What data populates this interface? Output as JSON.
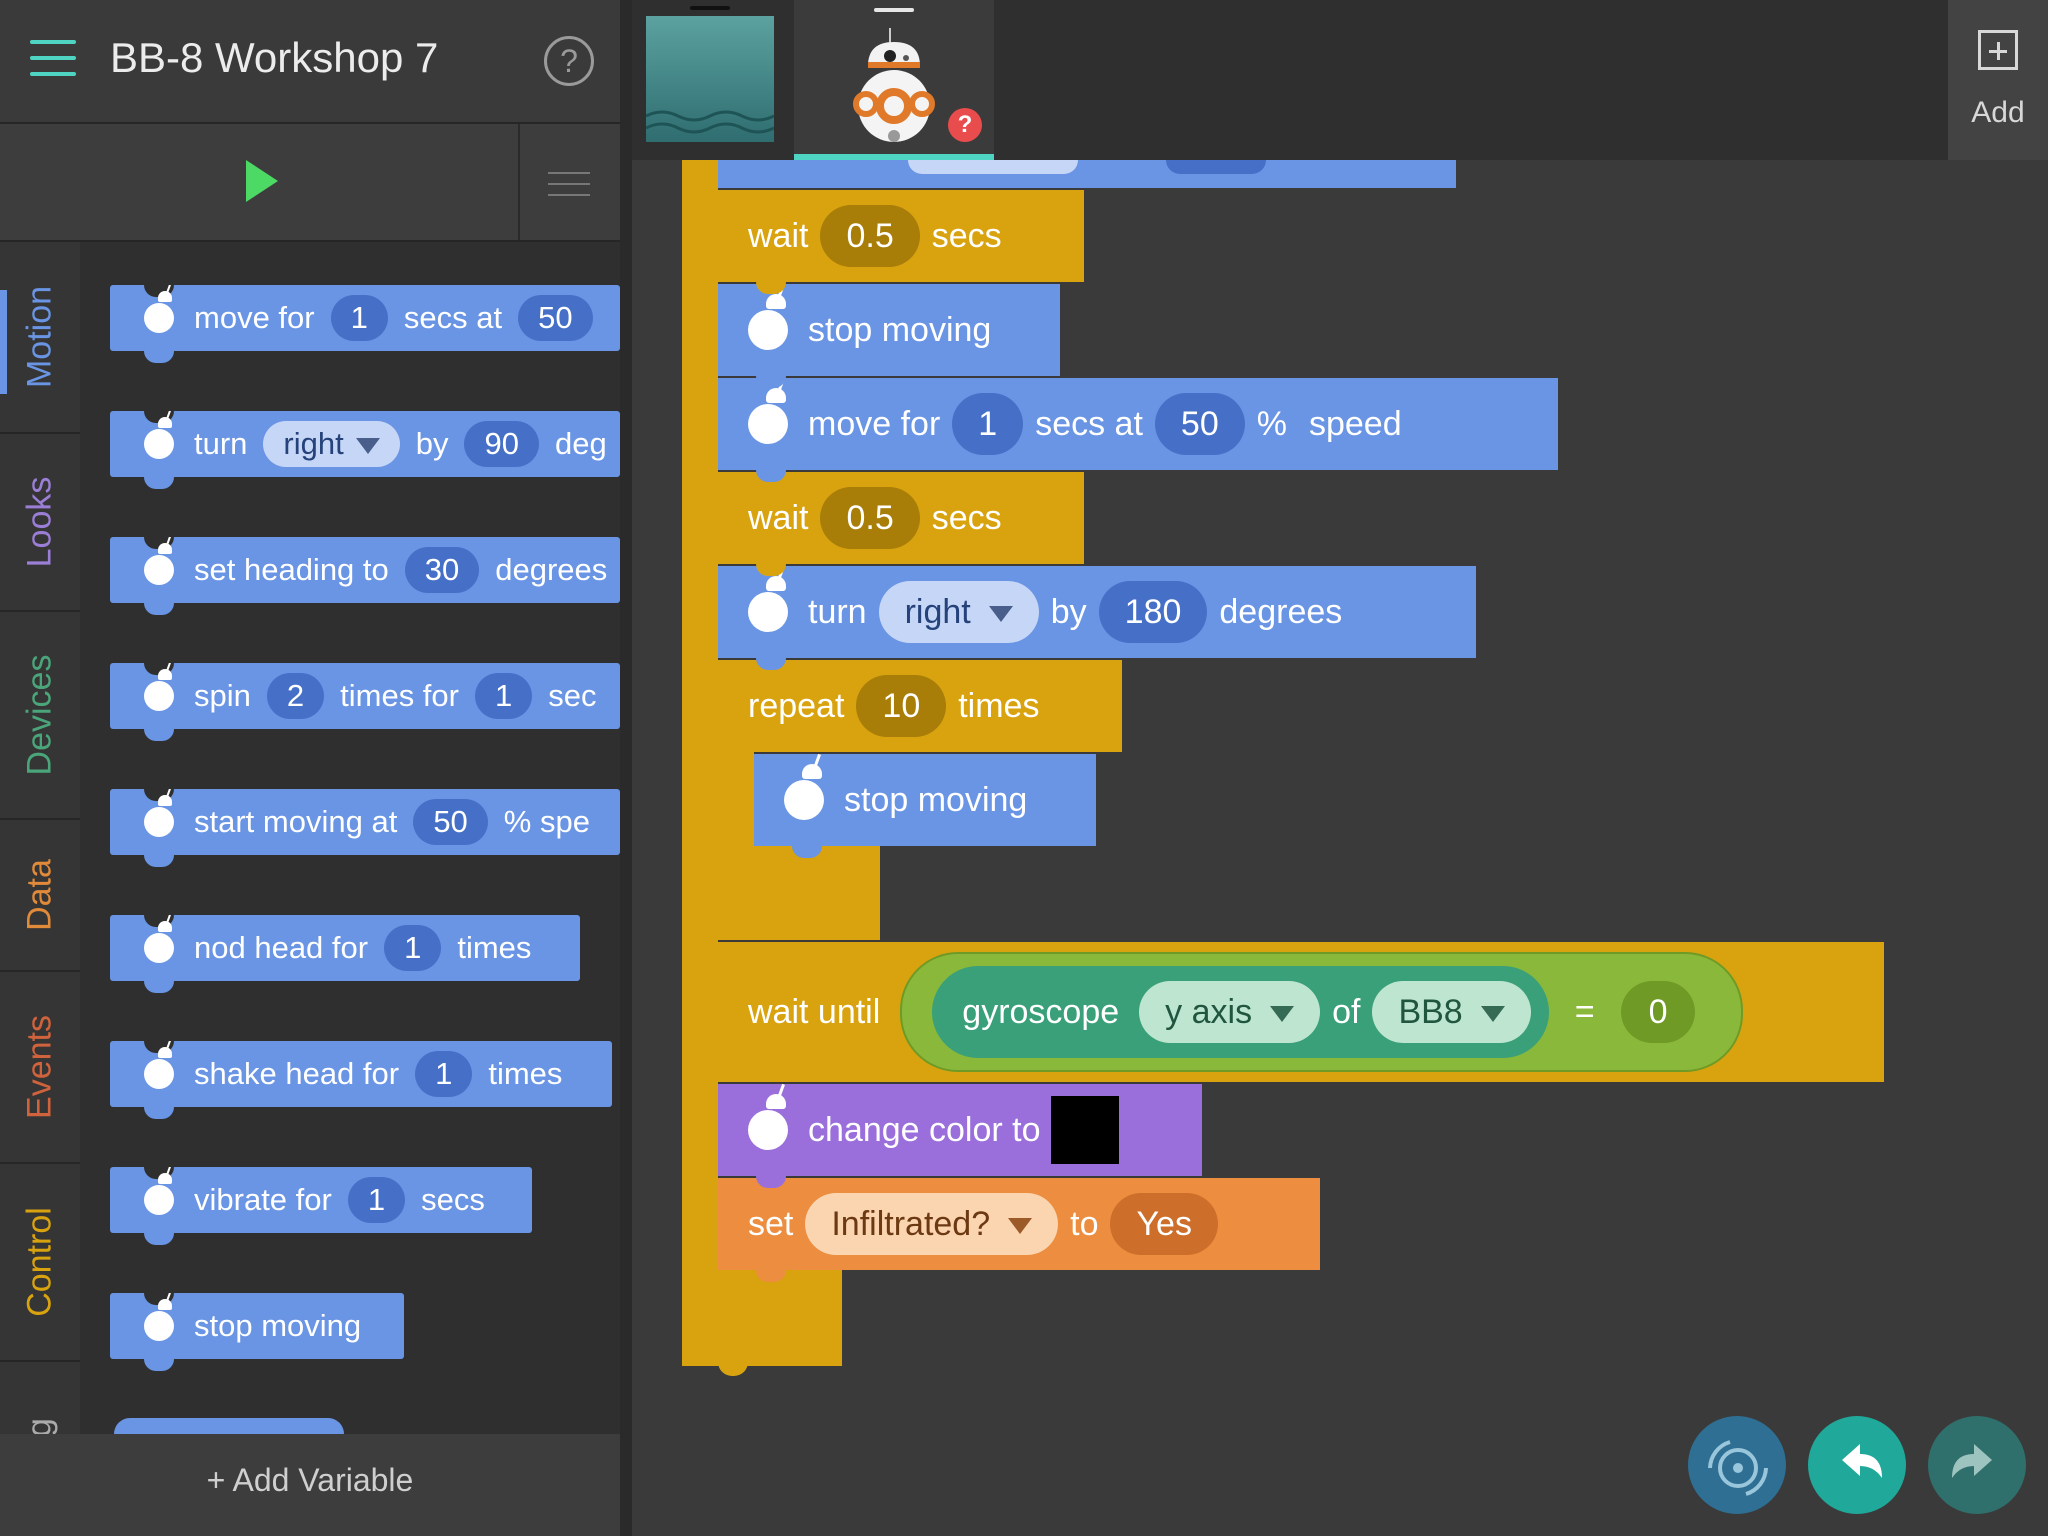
{
  "app": {
    "title": "BB-8 Workshop 7",
    "help_symbol": "?"
  },
  "categories": [
    {
      "label": "Motion",
      "color": "#6a95e4"
    },
    {
      "label": "Looks",
      "color": "#9b7fd6"
    },
    {
      "label": "Devices",
      "color": "#4aa57b"
    },
    {
      "label": "Data",
      "color": "#e08a3a"
    },
    {
      "label": "Events",
      "color": "#d0633c"
    },
    {
      "label": "Control",
      "color": "#d9a30f"
    },
    {
      "label": "ng",
      "color": "#aaaaaa"
    }
  ],
  "palette": {
    "move": {
      "text1": "move for",
      "secs": "1",
      "text2": "secs at",
      "speed": "50"
    },
    "turn": {
      "text1": "turn",
      "dir": "right",
      "text2": "by",
      "deg": "90",
      "text3": "deg"
    },
    "heading": {
      "text1": "set heading to",
      "deg": "30",
      "text2": "degrees"
    },
    "spin": {
      "text1": "spin",
      "times": "2",
      "text2": "times for",
      "secs": "1",
      "text3": "sec"
    },
    "start": {
      "text1": "start moving at",
      "speed": "50",
      "text2": "% spe"
    },
    "nod": {
      "text1": "nod head for",
      "times": "1",
      "text2": "times"
    },
    "shake": {
      "text1": "shake head for",
      "times": "1",
      "text2": "times"
    },
    "vibrate": {
      "text1": "vibrate for",
      "secs": "1",
      "text2": "secs"
    },
    "stop": {
      "text1": "stop moving"
    }
  },
  "add_variable": "+ Add Variable",
  "sprites": {
    "add_label": "Add",
    "warning": "?"
  },
  "script": {
    "wait1": {
      "text1": "wait",
      "secs": "0.5",
      "text2": "secs"
    },
    "stop1": {
      "text1": "stop moving"
    },
    "move": {
      "text1": "move for",
      "secs": "1",
      "text2": "secs at",
      "speed": "50",
      "text3": "%",
      "text4": "speed"
    },
    "wait2": {
      "text1": "wait",
      "secs": "0.5",
      "text2": "secs"
    },
    "turn": {
      "text1": "turn",
      "dir": "right",
      "text2": "by",
      "deg": "180",
      "text3": "degrees"
    },
    "repeat": {
      "text1": "repeat",
      "count": "10",
      "text2": "times"
    },
    "stop2": {
      "text1": "stop moving"
    },
    "wait_until": {
      "text1": "wait until",
      "sensor": "gyroscope",
      "axis": "y axis",
      "of": "of",
      "device": "BB8",
      "eq": "=",
      "value": "0"
    },
    "color": {
      "text1": "change color to",
      "swatch": "#000000"
    },
    "set": {
      "text1": "set",
      "var": "Infiltrated?",
      "text2": "to",
      "value": "Yes"
    }
  }
}
